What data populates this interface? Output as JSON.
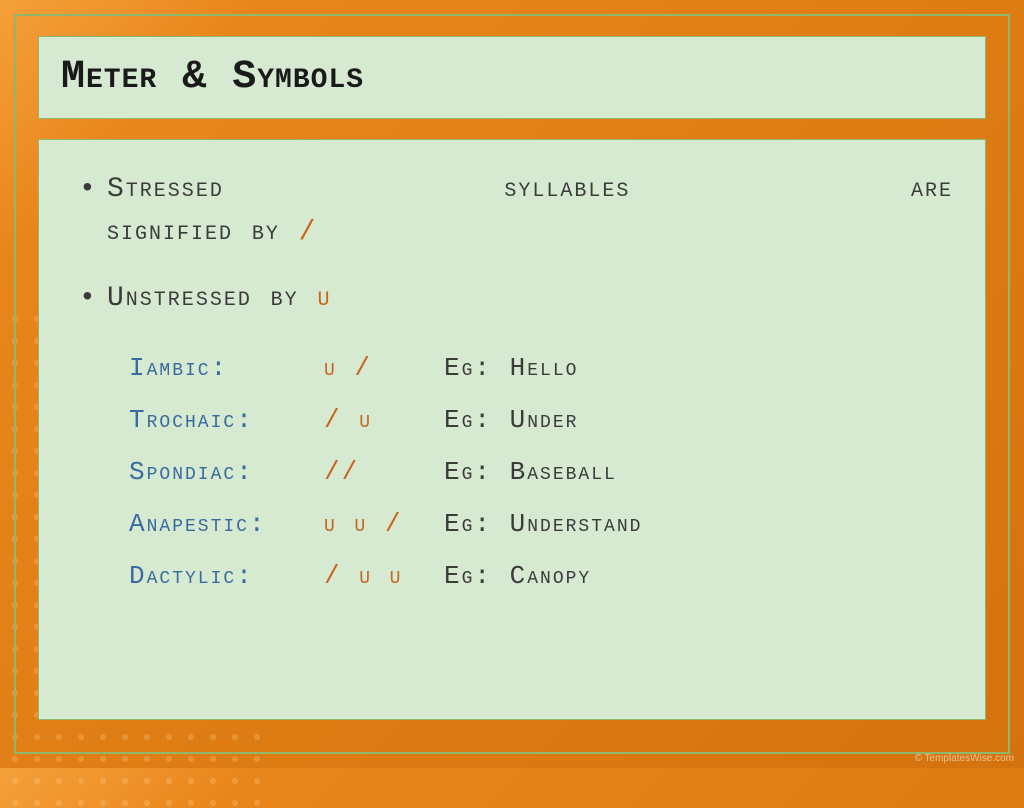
{
  "title": "Meter & Symbols",
  "bullets": {
    "line1a": "Stressed syllables are",
    "line1b": "signified by ",
    "line1_symbol": "/",
    "line2a": "Unstressed by ",
    "line2_symbol": "u"
  },
  "rows": [
    {
      "label": "Iambic:",
      "pattern": [
        {
          "t": "u",
          "c": "orange"
        },
        {
          "t": " / ",
          "c": "orange"
        }
      ],
      "eg": "Eg: Hello"
    },
    {
      "label": "Trochaic:",
      "pattern": [
        {
          "t": "/ ",
          "c": "orange"
        },
        {
          "t": "u",
          "c": "orange"
        }
      ],
      "eg": "Eg: Under"
    },
    {
      "label": "Spondiac:",
      "pattern": [
        {
          "t": "//",
          "c": "orange"
        }
      ],
      "eg": "Eg: Baseball"
    },
    {
      "label": "Anapestic:",
      "pattern": [
        {
          "t": "u u ",
          "c": "orange"
        },
        {
          "t": "/",
          "c": "orange"
        }
      ],
      "eg": "Eg: Understand"
    },
    {
      "label": "Dactylic:",
      "pattern": [
        {
          "t": "/ ",
          "c": "orange"
        },
        {
          "t": "u u",
          "c": "orange"
        }
      ],
      "eg": "Eg: Canopy"
    }
  ],
  "watermark": "© TemplatesWise.com"
}
